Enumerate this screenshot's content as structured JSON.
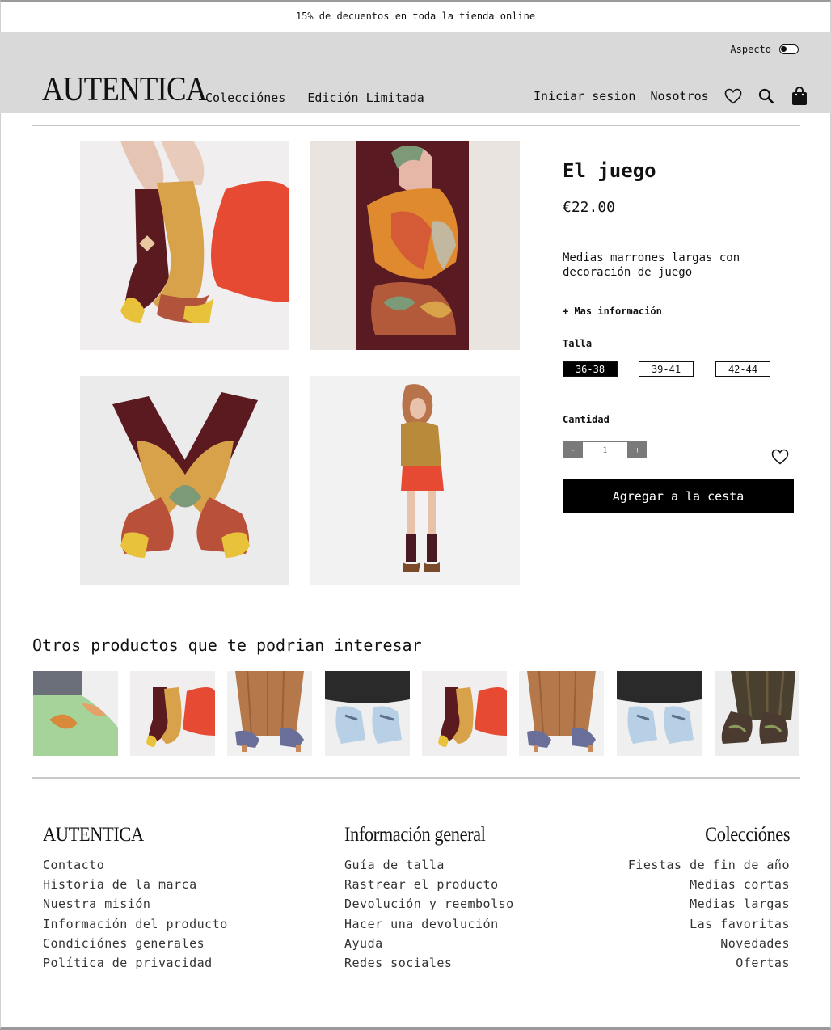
{
  "promo": {
    "text": "15% de decuentos en toda la tienda online"
  },
  "header": {
    "aspect_label": "Aspecto",
    "logo": "AUTENTICA",
    "nav_left": [
      "Colecciónes",
      "Edición Limitada"
    ],
    "nav_right": [
      "Iniciar sesion",
      "Nosotros"
    ],
    "icons": [
      "heart-icon",
      "search-icon",
      "bag-icon"
    ]
  },
  "product": {
    "title": "El juego",
    "price": "€22.00",
    "description": "Medias marrones largas con decoración de juego",
    "more_info": "+ Mas información",
    "size_label": "Talla",
    "sizes": [
      "36-38",
      "39-41",
      "42-44"
    ],
    "selected_size": "36-38",
    "quantity_label": "Cantidad",
    "quantity": "1",
    "minus": "-",
    "plus": "+",
    "add_to_cart": "Agregar a la cesta"
  },
  "related": {
    "title": "Otros productos que te podrian interesar"
  },
  "footer": {
    "col1": {
      "heading": "AUTENTICA",
      "links": [
        "Contacto",
        "Historia de la marca",
        "Nuestra misión",
        "Información del producto",
        "Condiciónes generales",
        "Política de privacidad"
      ]
    },
    "col2": {
      "heading": "Información general",
      "links": [
        "Guía de talla",
        "Rastrear el producto",
        "Devolución y reembolso",
        "Hacer una devolución",
        "Ayuda",
        "Redes sociales"
      ]
    },
    "col3": {
      "heading": "Colecciónes",
      "links": [
        "Fiestas de fin de año",
        "Medias cortas",
        "Medias largas",
        "Las favoritas",
        "Novedades",
        "Ofertas"
      ]
    }
  },
  "colors": {
    "header_bg": "#d9d9d9",
    "accent": "#000000",
    "stepper": "#7a7a7a"
  }
}
